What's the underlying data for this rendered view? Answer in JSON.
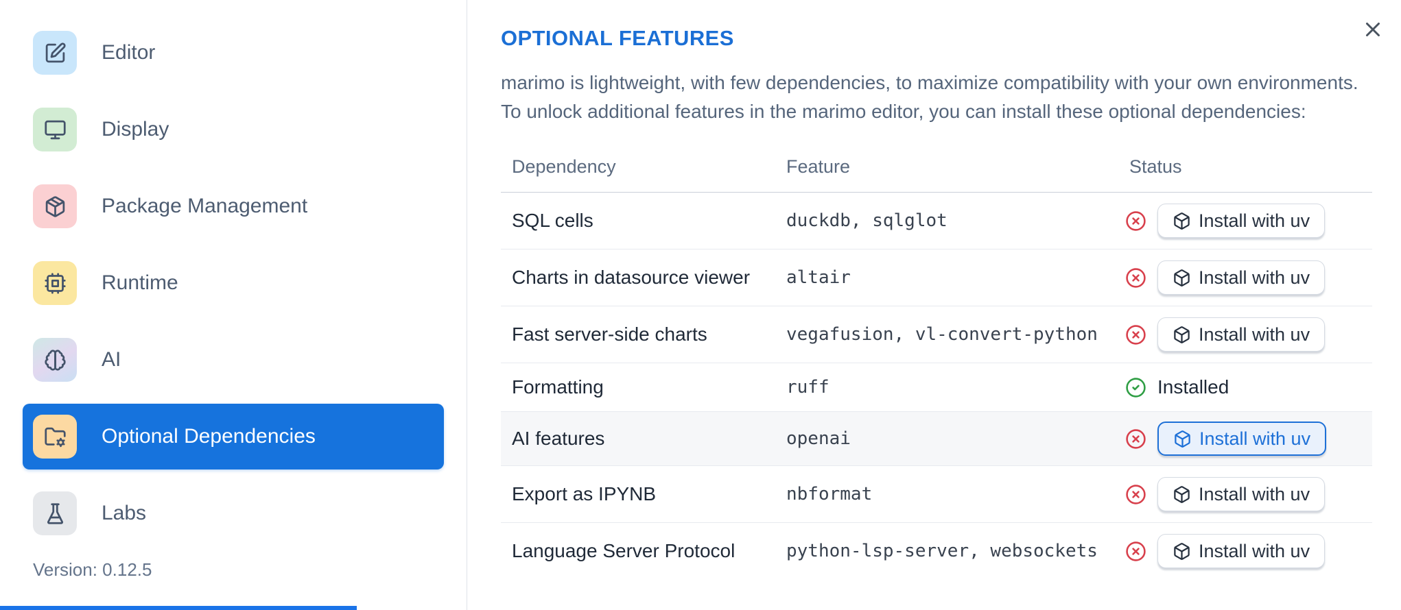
{
  "dialog": {
    "close_icon": "x-icon"
  },
  "sidebar": {
    "items": [
      {
        "label": "Editor",
        "icon": "square-pen-icon",
        "tile": "editor",
        "selected": false
      },
      {
        "label": "Display",
        "icon": "monitor-icon",
        "tile": "display",
        "selected": false
      },
      {
        "label": "Package Management",
        "icon": "package-icon",
        "tile": "package",
        "selected": false
      },
      {
        "label": "Runtime",
        "icon": "cpu-icon",
        "tile": "runtime",
        "selected": false
      },
      {
        "label": "AI",
        "icon": "brain-icon",
        "tile": "ai",
        "selected": false
      },
      {
        "label": "Optional Dependencies",
        "icon": "folder-cog-icon",
        "tile": "optional",
        "selected": true
      },
      {
        "label": "Labs",
        "icon": "flask-icon",
        "tile": "labs",
        "selected": false
      }
    ],
    "version": "Version: 0.12.5"
  },
  "main": {
    "title": "OPTIONAL FEATURES",
    "description_line1": "marimo is lightweight, with few dependencies, to maximize compatibility with your own environments.",
    "description_line2": "To unlock additional features in the marimo editor, you can install these optional dependencies:",
    "table": {
      "columns": [
        "Dependency",
        "Feature",
        "Status"
      ],
      "install_button_label": "Install with uv",
      "installed_label": "Installed",
      "rows": [
        {
          "dependency": "SQL cells",
          "feature": "duckdb, sqlglot",
          "installed": false,
          "highlighted": false
        },
        {
          "dependency": "Charts in datasource viewer",
          "feature": "altair",
          "installed": false,
          "highlighted": false
        },
        {
          "dependency": "Fast server-side charts",
          "feature": "vegafusion, vl-convert-python",
          "installed": false,
          "highlighted": false
        },
        {
          "dependency": "Formatting",
          "feature": "ruff",
          "installed": true,
          "highlighted": false
        },
        {
          "dependency": "AI features",
          "feature": "openai",
          "installed": false,
          "highlighted": true
        },
        {
          "dependency": "Export as IPYNB",
          "feature": "nbformat",
          "installed": false,
          "highlighted": false
        },
        {
          "dependency": "Language Server Protocol",
          "feature": "python-lsp-server, websockets",
          "installed": false,
          "highlighted": false
        }
      ]
    }
  },
  "colors": {
    "accent_blue": "#1673dd",
    "title_blue": "#1b6fd5",
    "error_red": "#d8404c",
    "success_green": "#2f9e44"
  }
}
